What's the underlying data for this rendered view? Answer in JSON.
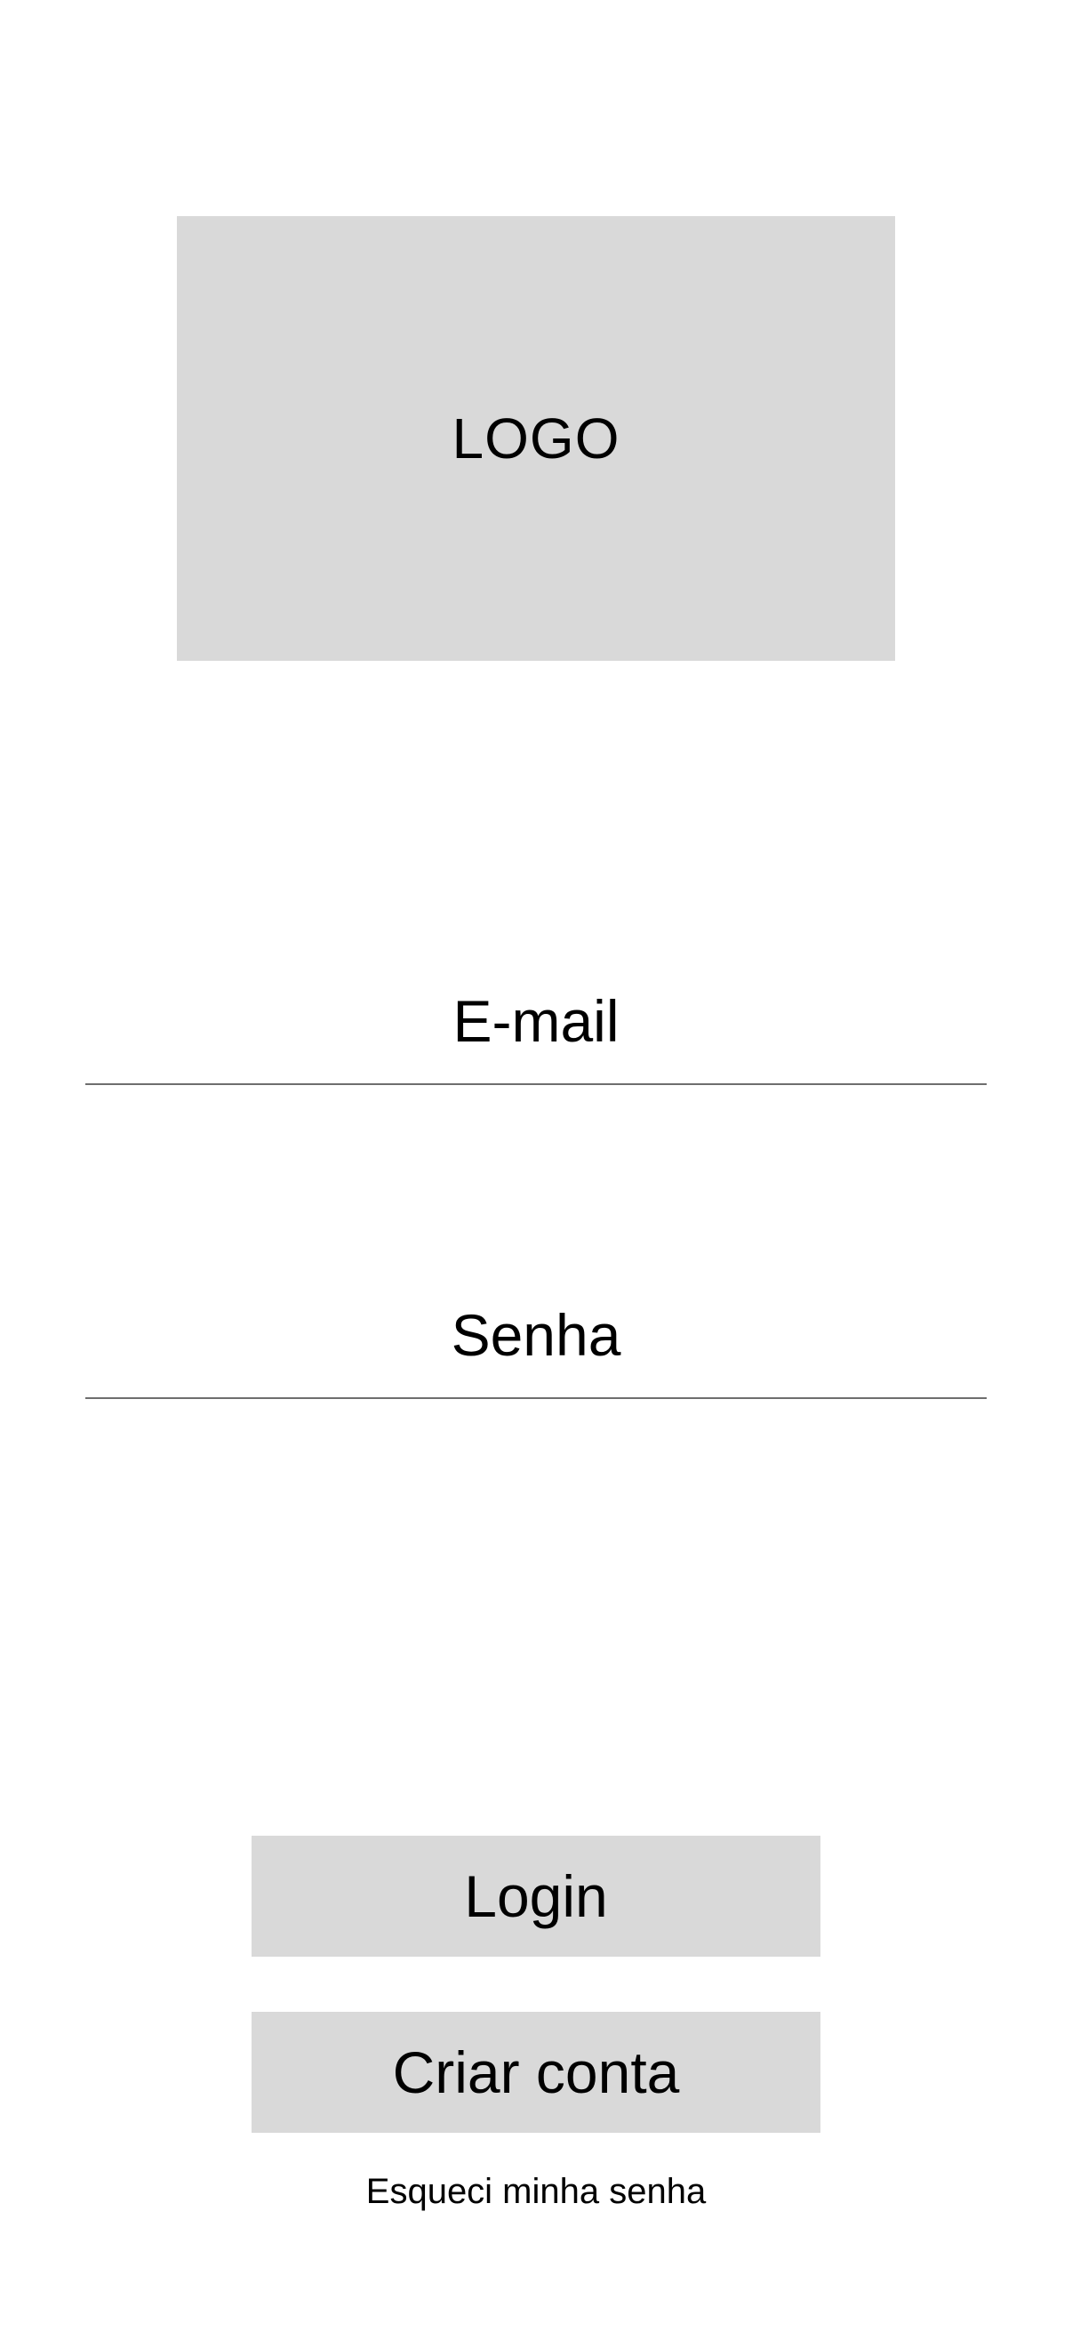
{
  "logo": {
    "text": "LOGO"
  },
  "form": {
    "email_label": "E-mail",
    "password_label": "Senha"
  },
  "actions": {
    "login_label": "Login",
    "create_account_label": "Criar conta",
    "forgot_password_label": "Esqueci minha senha"
  },
  "colors": {
    "placeholder_gray": "#d9d9d9",
    "divider": "#6e6e6e",
    "text": "#000000",
    "background": "#ffffff"
  }
}
